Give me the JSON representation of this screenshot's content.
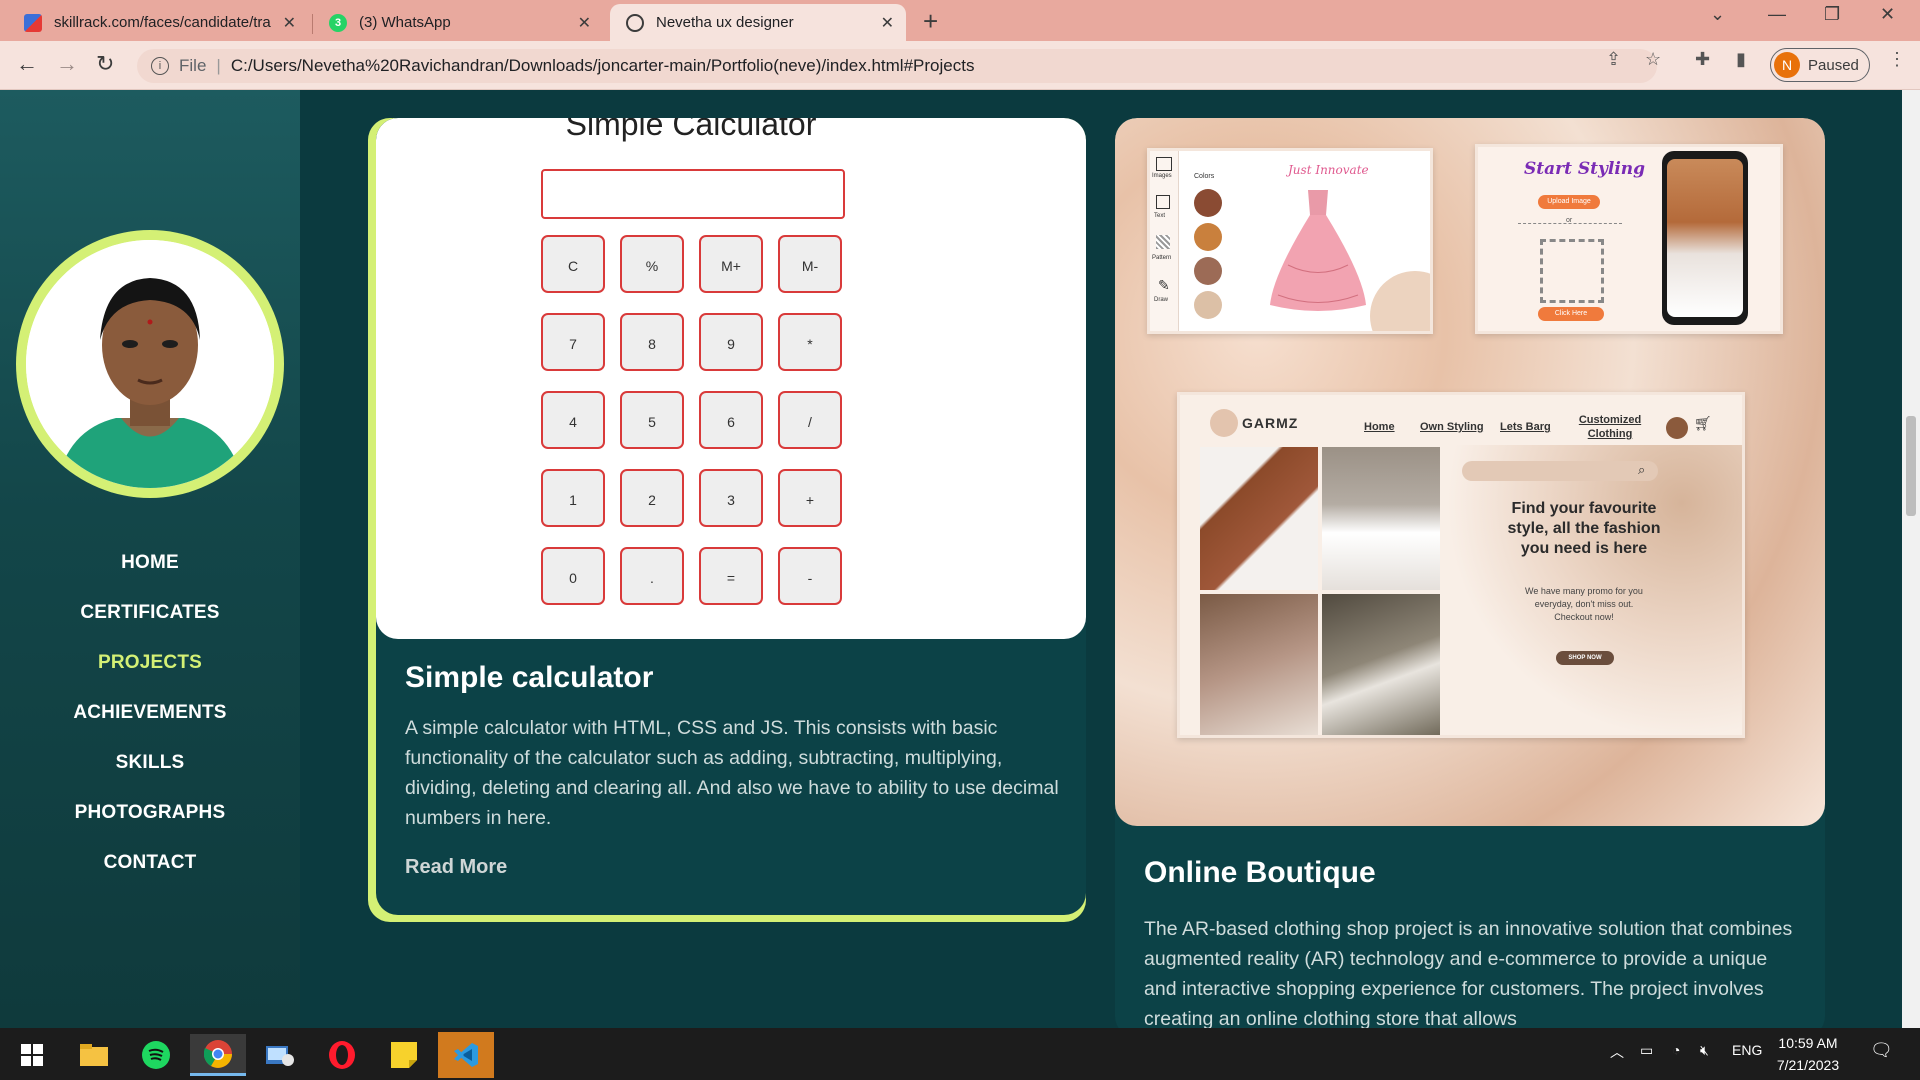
{
  "browser": {
    "tabs": [
      {
        "title": "skillrack.com/faces/candidate/tra",
        "active": false
      },
      {
        "title": "(3) WhatsApp",
        "active": false
      },
      {
        "title": "Nevetha ux designer",
        "active": true
      }
    ],
    "new_tab": "+",
    "url_prefix": "File",
    "url": "C:/Users/Nevetha%20Ravichandran/Downloads/joncarter-main/Portfolio(neve)/index.html#Projects",
    "profile_initial": "N",
    "profile_status": "Paused"
  },
  "sidebar": {
    "nav": [
      {
        "label": "HOME",
        "active": false
      },
      {
        "label": "CERTIFICATES",
        "active": false
      },
      {
        "label": "PROJECTS",
        "active": true
      },
      {
        "label": "ACHIEVEMENTS",
        "active": false
      },
      {
        "label": "SKILLS",
        "active": false
      },
      {
        "label": "PHOTOGRAPHS",
        "active": false
      },
      {
        "label": "CONTACT",
        "active": false
      }
    ]
  },
  "projects": [
    {
      "preview_heading": "Simple Calculator",
      "calculator_keys": [
        "C",
        "%",
        "M+",
        "M-",
        "7",
        "8",
        "9",
        "*",
        "4",
        "5",
        "6",
        "/",
        "1",
        "2",
        "3",
        "+",
        "0",
        ".",
        "=",
        "-"
      ],
      "title": "Simple calculator",
      "description": "A simple calculator with HTML, CSS and JS. This consists with basic functionality of the calculator such as adding, subtracting, multiplying, dividing, deleting and clearing all. And also we have to ability to use decimal numbers in here.",
      "link": "Read More"
    },
    {
      "title": "Online Boutique",
      "description": "The AR-based clothing shop project is an innovative solution that combines augmented reality (AR) technology and e-commerce to provide a unique and interactive shopping experience for customers. The project involves creating an online clothing store that allows",
      "mockups": {
        "editor_tools": [
          "Images",
          "Text",
          "Pattern",
          "Draw"
        ],
        "editor_colors_label": "Colors",
        "editor_heading": "Just Innovate",
        "styling_heading": "Start Styling",
        "styling_upload": "Upload Image",
        "styling_or": "or",
        "styling_click": "Click Here",
        "site_logo": "GARMZ",
        "site_nav": [
          "Home",
          "Own Styling",
          "Lets Barg",
          "Customized Clothing"
        ],
        "site_headline": "Find your favourite style, all the fashion you need is here",
        "site_sub": "We have many promo for you everyday, don't miss out. Checkout now!",
        "site_cta": "SHOP NOW"
      }
    }
  ],
  "taskbar": {
    "language": "ENG",
    "time": "10:59 AM",
    "date": "7/21/2023"
  },
  "colors": {
    "accent": "#d4f075",
    "page_bg": "#0b3a3f",
    "card_bg": "#0c4247",
    "calc_border": "#d93a3a",
    "tab_strip": "#e8a99e"
  }
}
